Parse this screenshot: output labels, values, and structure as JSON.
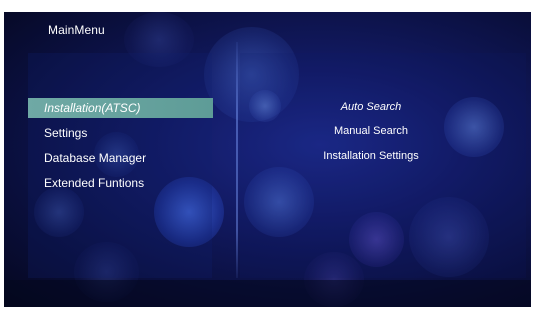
{
  "window": {
    "title": "MainMenu"
  },
  "main_menu": {
    "items": [
      {
        "label": "Installation(ATSC)",
        "selected": true
      },
      {
        "label": "Settings",
        "selected": false
      },
      {
        "label": "Database Manager",
        "selected": false
      },
      {
        "label": "Extended Funtions",
        "selected": false
      }
    ]
  },
  "submenu": {
    "items": [
      {
        "label": "Auto Search",
        "highlighted": true
      },
      {
        "label": "Manual Search",
        "highlighted": false
      },
      {
        "label": "Installation Settings",
        "highlighted": false
      }
    ]
  },
  "theme": {
    "background": "#121a63",
    "selection_color": "#6fa9a5",
    "text_color": "#ffffff"
  }
}
